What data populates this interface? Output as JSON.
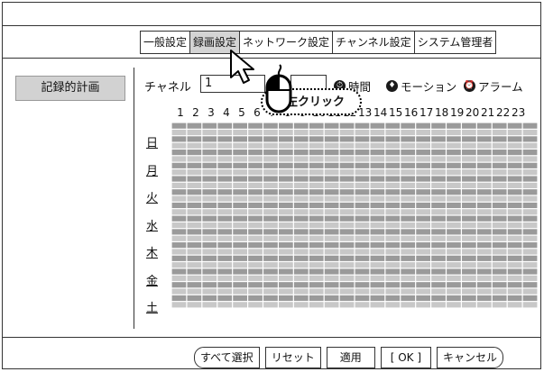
{
  "tabs": [
    {
      "label": "一般設定",
      "active": false
    },
    {
      "label": "録画設定",
      "active": true
    },
    {
      "label": "ネットワーク設定",
      "active": false
    },
    {
      "label": "チャンネル設定",
      "active": false
    },
    {
      "label": "システム管理者",
      "active": false
    }
  ],
  "sidebar": {
    "schedule_label": "記録的計画"
  },
  "channel": {
    "label": "チャネル",
    "value": "1"
  },
  "legend": [
    {
      "icon": "clock-icon",
      "glyph": "⏱",
      "label": "時間"
    },
    {
      "icon": "motion-icon",
      "glyph": "♦",
      "label": "モーション"
    },
    {
      "icon": "alarm-icon",
      "glyph": "⏰",
      "label": "アラーム"
    }
  ],
  "hours": [
    "1",
    "2",
    "3",
    "4",
    "5",
    "6",
    "7",
    "8",
    "9",
    "10",
    "11",
    "12",
    "13",
    "14",
    "15",
    "16",
    "17",
    "18",
    "19",
    "20",
    "21",
    "22",
    "23"
  ],
  "days": [
    "日",
    "月",
    "火",
    "水",
    "木",
    "金",
    "土"
  ],
  "annotation": {
    "text": "左クリック"
  },
  "buttons": {
    "select_all": "すべて選択",
    "reset": "リセット",
    "apply": "適用",
    "ok": "[ OK ]",
    "cancel": "キャンセル"
  },
  "colors": {
    "cell_dark": "#9a9a9a",
    "cell_light": "#c8c8c8",
    "active_tab": "#d4d4d4",
    "side_button": "#d2d2d2"
  }
}
